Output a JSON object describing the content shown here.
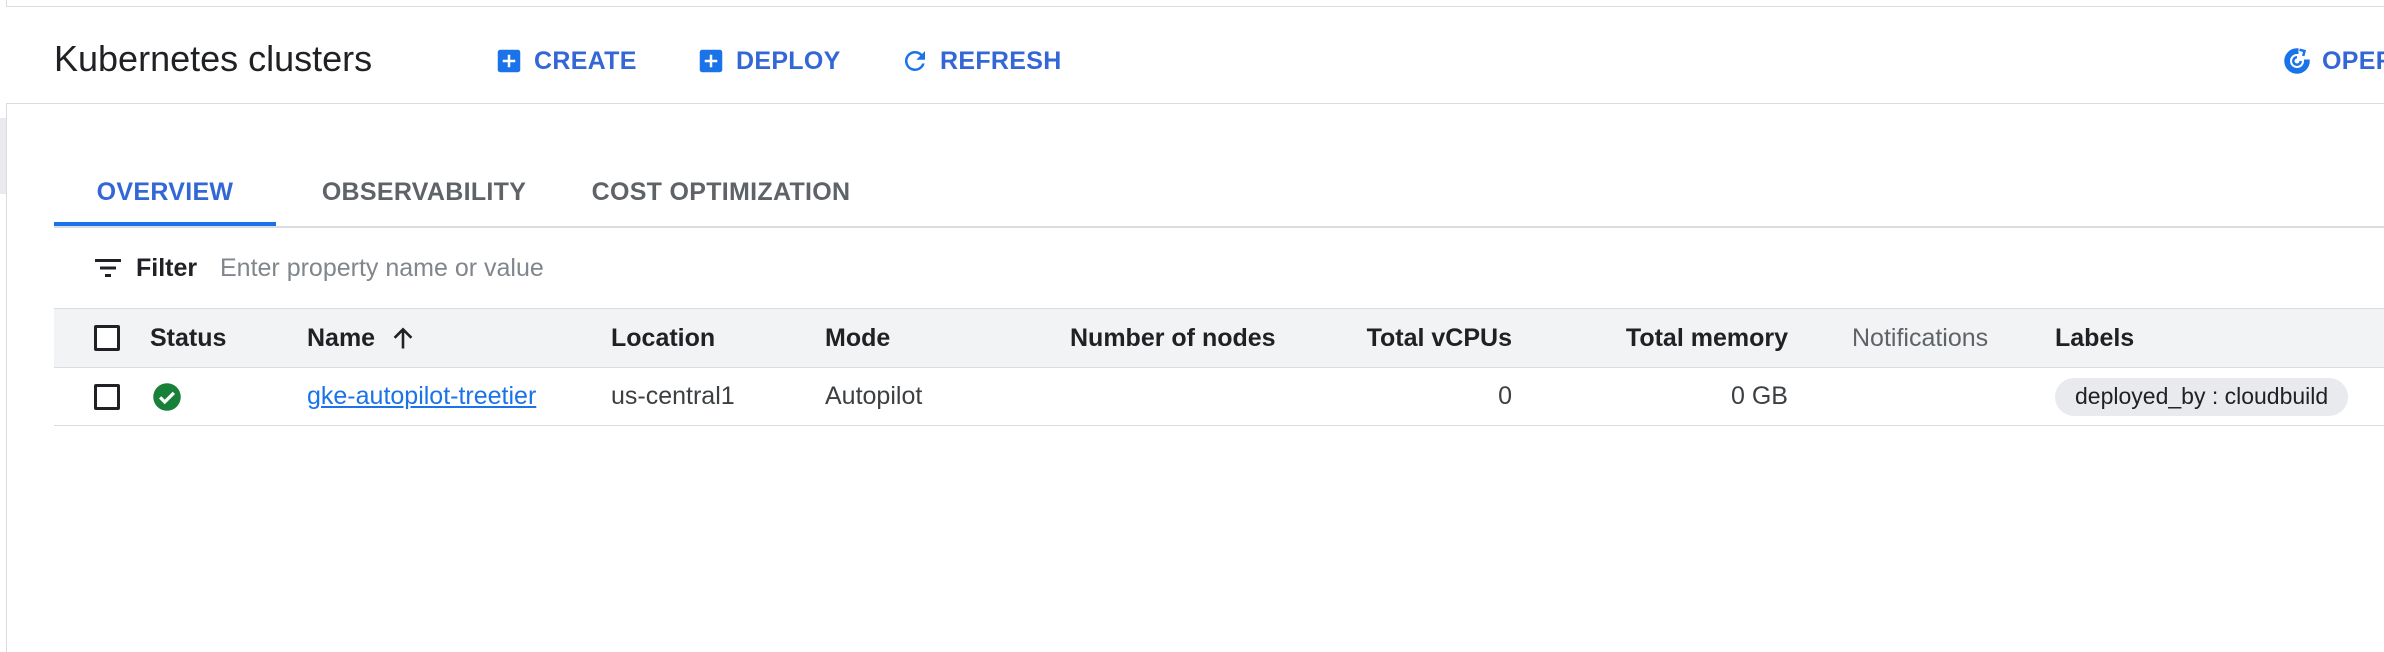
{
  "header": {
    "title": "Kubernetes clusters",
    "actions": {
      "create": "CREATE",
      "deploy": "DEPLOY",
      "refresh": "REFRESH",
      "operations": "OPER"
    }
  },
  "tabs": [
    {
      "label": "OVERVIEW",
      "active": true
    },
    {
      "label": "OBSERVABILITY",
      "active": false
    },
    {
      "label": "COST OPTIMIZATION",
      "active": false
    }
  ],
  "filter": {
    "label": "Filter",
    "placeholder": "Enter property name or value"
  },
  "table": {
    "columns": {
      "status": "Status",
      "name": "Name",
      "location": "Location",
      "mode": "Mode",
      "nodes": "Number of nodes",
      "vcpus": "Total vCPUs",
      "memory": "Total memory",
      "notifications": "Notifications",
      "labels": "Labels"
    },
    "rows": [
      {
        "status": "ok",
        "name": "gke-autopilot-treetier",
        "location": "us-central1",
        "mode": "Autopilot",
        "nodes": "",
        "vcpus": "0",
        "memory": "0 GB",
        "notifications": "",
        "label": "deployed_by : cloudbuild"
      }
    ]
  },
  "colors": {
    "accent": "#1a73e8",
    "status_ok": "#188038",
    "border": "#dadce0",
    "header_bg": "#f1f3f4"
  },
  "icons": {
    "create": "add-box-icon",
    "deploy": "add-box-icon",
    "refresh": "refresh-icon",
    "operations": "operations-icon",
    "filter": "filter-list-icon",
    "sort": "arrow-upward-icon",
    "status": "check-circle-icon"
  }
}
